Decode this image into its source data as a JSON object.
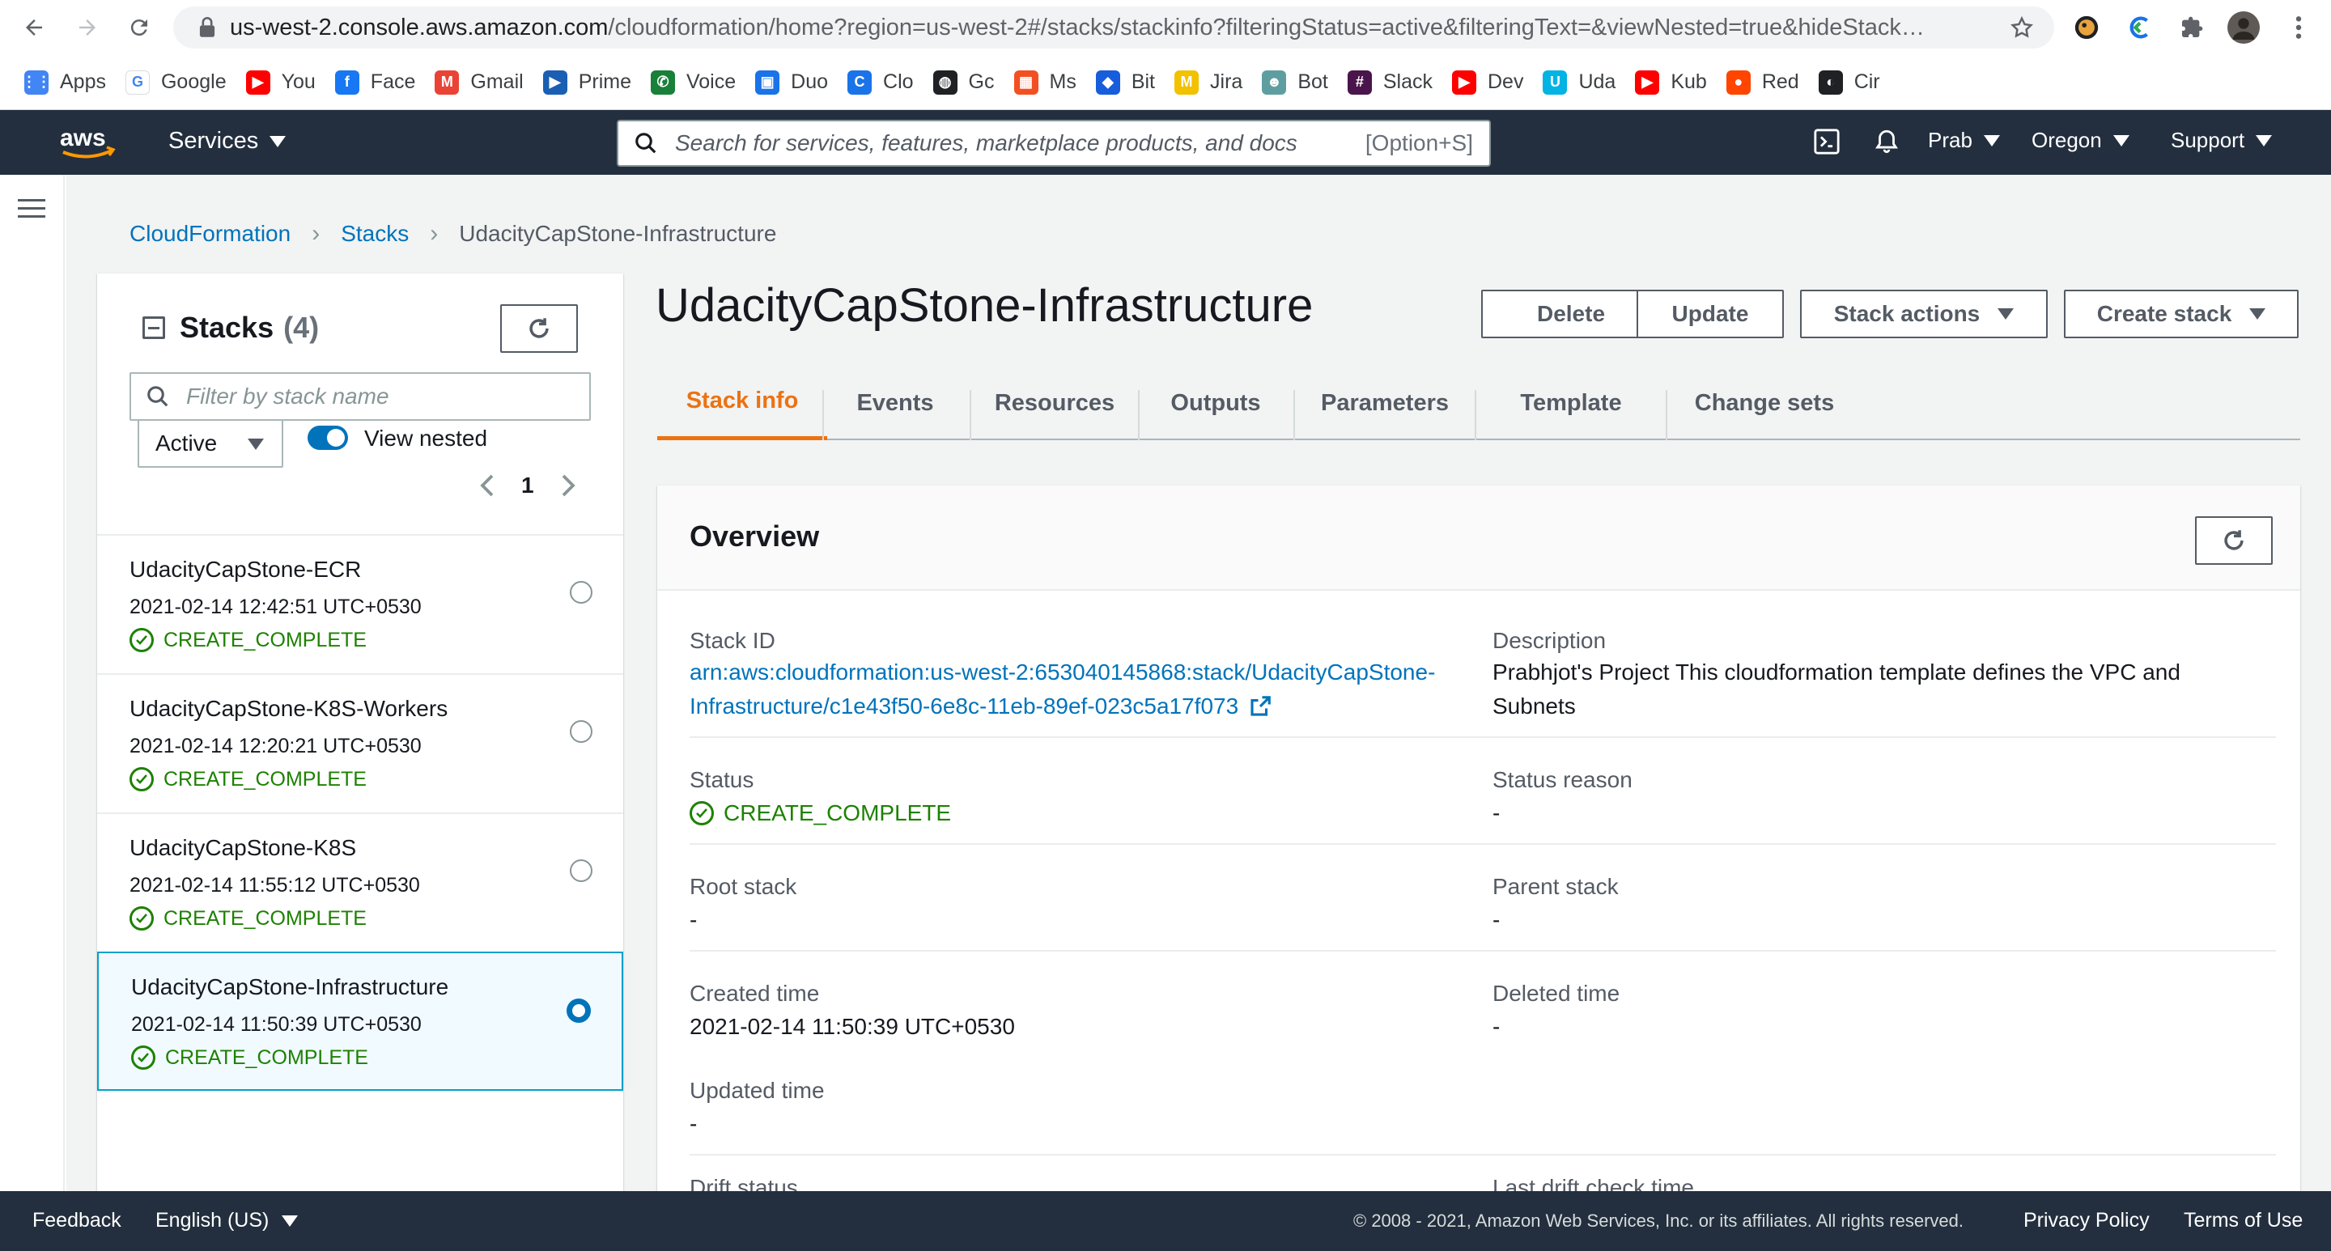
{
  "browser": {
    "url_host": "us-west-2.console.aws.amazon.com",
    "url_path": "/cloudformation/home?region=us-west-2#/stacks/stackinfo?filteringStatus=active&filteringText=&viewNested=true&hideStack…"
  },
  "bookmarks": [
    {
      "label": "Apps",
      "icon": "apps-grid-icon",
      "color": "#4285f4",
      "glyph": "⋮⋮"
    },
    {
      "label": "Google",
      "icon": "google-icon",
      "color": "#ffffff",
      "glyph": "G"
    },
    {
      "label": "You",
      "icon": "youtube-icon",
      "color": "#ff0000",
      "glyph": "▶"
    },
    {
      "label": "Face",
      "icon": "facebook-icon",
      "color": "#1877f2",
      "glyph": "f"
    },
    {
      "label": "Gmail",
      "icon": "gmail-icon",
      "color": "#ea4335",
      "glyph": "M"
    },
    {
      "label": "Prime",
      "icon": "prime-icon",
      "color": "#1a5fb4",
      "glyph": "▶"
    },
    {
      "label": "Voice",
      "icon": "voice-icon",
      "color": "#188038",
      "glyph": "✆"
    },
    {
      "label": "Duo",
      "icon": "duo-icon",
      "color": "#1a73e8",
      "glyph": "▣"
    },
    {
      "label": "Clo",
      "icon": "cloud-icon",
      "color": "#1a73e8",
      "glyph": "C"
    },
    {
      "label": "Gc",
      "icon": "globe-icon",
      "color": "#202124",
      "glyph": "◍"
    },
    {
      "label": "Ms",
      "icon": "microsoft-icon",
      "color": "#f25022",
      "glyph": "▦"
    },
    {
      "label": "Bit",
      "icon": "bitwarden-icon",
      "color": "#175ddc",
      "glyph": "◆"
    },
    {
      "label": "Jira",
      "icon": "jira-icon",
      "color": "#f2c100",
      "glyph": "M"
    },
    {
      "label": "Bot",
      "icon": "bot-icon",
      "color": "#5f9ea0",
      "glyph": "☻"
    },
    {
      "label": "Slack",
      "icon": "slack-icon",
      "color": "#4a154b",
      "glyph": "#"
    },
    {
      "label": "Dev",
      "icon": "dev-icon",
      "color": "#ff0000",
      "glyph": "▶"
    },
    {
      "label": "Uda",
      "icon": "udacity-icon",
      "color": "#02b3e4",
      "glyph": "U"
    },
    {
      "label": "Kub",
      "icon": "kube-icon",
      "color": "#ff0000",
      "glyph": "▶"
    },
    {
      "label": "Red",
      "icon": "reddit-icon",
      "color": "#ff4500",
      "glyph": "●"
    },
    {
      "label": "Cir",
      "icon": "circle-icon",
      "color": "#202124",
      "glyph": "◐"
    }
  ],
  "awsnav": {
    "services": "Services",
    "search_placeholder": "Search for services, features, marketplace products, and docs",
    "search_shortcut": "[Option+S]",
    "user": "Prab",
    "region": "Oregon",
    "support": "Support"
  },
  "breadcrumb": {
    "root": "CloudFormation",
    "stacks": "Stacks",
    "current": "UdacityCapStone-Infrastructure"
  },
  "stacks_panel": {
    "title": "Stacks",
    "count": "(4)",
    "filter_placeholder": "Filter by stack name",
    "status_filter": "Active",
    "view_nested_label": "View nested",
    "view_nested_on": true,
    "page": "1",
    "items": [
      {
        "name": "UdacityCapStone-ECR",
        "date": "2021-02-14 12:42:51 UTC+0530",
        "status": "CREATE_COMPLETE",
        "selected": false
      },
      {
        "name": "UdacityCapStone-K8S-Workers",
        "date": "2021-02-14 12:20:21 UTC+0530",
        "status": "CREATE_COMPLETE",
        "selected": false
      },
      {
        "name": "UdacityCapStone-K8S",
        "date": "2021-02-14 11:55:12 UTC+0530",
        "status": "CREATE_COMPLETE",
        "selected": false
      },
      {
        "name": "UdacityCapStone-Infrastructure",
        "date": "2021-02-14 11:50:39 UTC+0530",
        "status": "CREATE_COMPLETE",
        "selected": true
      }
    ]
  },
  "stack": {
    "title": "UdacityCapStone-Infrastructure",
    "actions": {
      "delete": "Delete",
      "update": "Update",
      "stack_actions": "Stack actions",
      "create_stack": "Create stack"
    },
    "tabs": [
      "Stack info",
      "Events",
      "Resources",
      "Outputs",
      "Parameters",
      "Template",
      "Change sets"
    ],
    "active_tab": "Stack info"
  },
  "overview": {
    "title": "Overview",
    "stack_id_label": "Stack ID",
    "stack_id_line1": "arn:aws:cloudformation:us-west-2:653040145868:stack/UdacityCapStone-",
    "stack_id_line2": "Infrastructure/c1e43f50-6e8c-11eb-89ef-023c5a17f073",
    "description_label": "Description",
    "description_line1": "Prabhjot's Project This cloudformation template defines the VPC and",
    "description_line2": "Subnets",
    "status_label": "Status",
    "status_value": "CREATE_COMPLETE",
    "status_reason_label": "Status reason",
    "status_reason_value": "-",
    "root_stack_label": "Root stack",
    "root_stack_value": "-",
    "parent_stack_label": "Parent stack",
    "parent_stack_value": "-",
    "created_time_label": "Created time",
    "created_time_value": "2021-02-14 11:50:39 UTC+0530",
    "deleted_time_label": "Deleted time",
    "deleted_time_value": "-",
    "updated_time_label": "Updated time",
    "updated_time_value": "-",
    "drift_status_label": "Drift status",
    "last_drift_label": "Last drift check time"
  },
  "footer": {
    "feedback": "Feedback",
    "language": "English (US)",
    "copyright": "© 2008 - 2021, Amazon Web Services, Inc. or its affiliates. All rights reserved.",
    "privacy": "Privacy Policy",
    "terms": "Terms of Use"
  },
  "colors": {
    "aws_nav": "#232f3e",
    "link": "#0073bb",
    "success": "#1d8102",
    "active_tab": "#ec7211"
  }
}
